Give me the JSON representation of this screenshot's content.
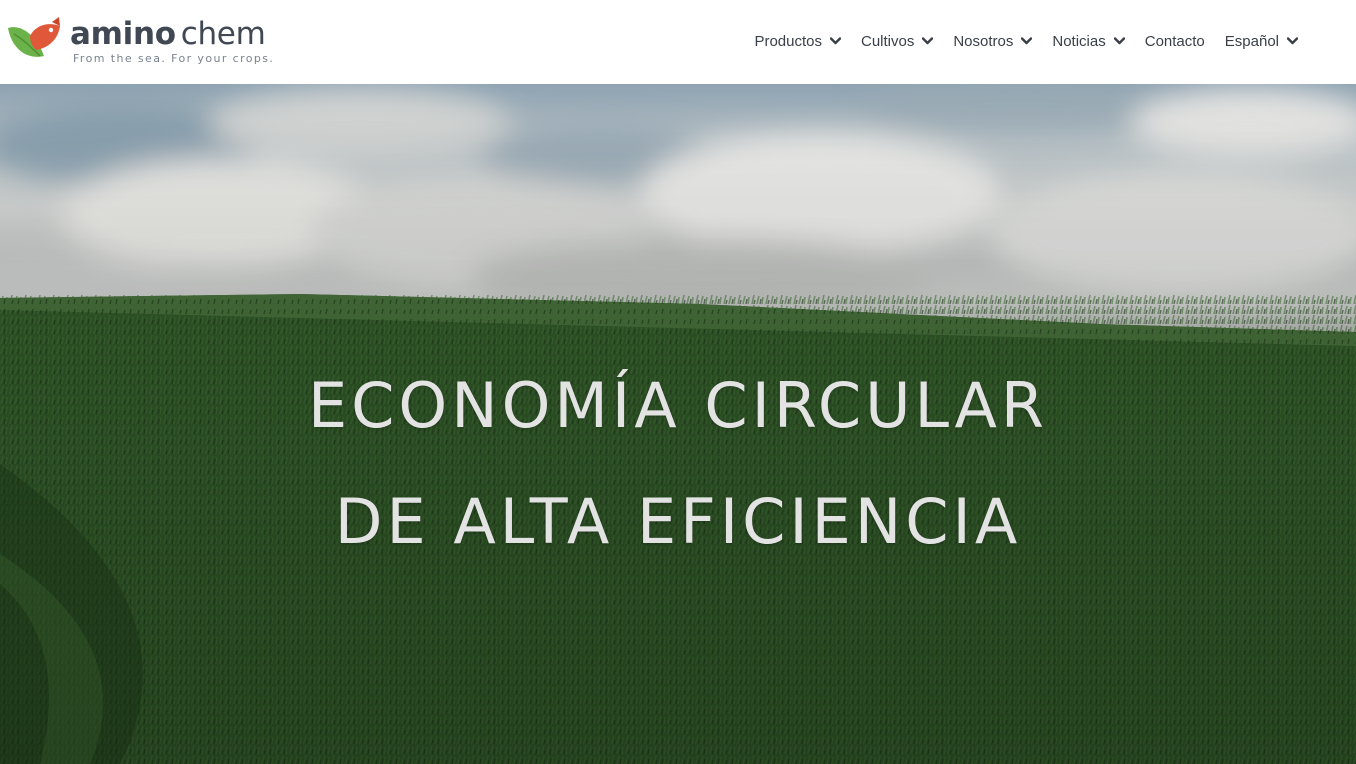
{
  "brand": {
    "name_bold": "amino",
    "name_light": "chem",
    "tagline": "From the sea. For your crops.",
    "colors": {
      "text": "#3f4853",
      "leaf": "#6bb24a",
      "fish": "#e0583a"
    }
  },
  "nav": {
    "items": [
      {
        "label": "Productos",
        "has_dropdown": true,
        "icon": "chevron-down-icon"
      },
      {
        "label": "Cultivos",
        "has_dropdown": true,
        "icon": "chevron-down-icon"
      },
      {
        "label": "Nosotros",
        "has_dropdown": true,
        "icon": "chevron-down-icon"
      },
      {
        "label": "Noticias",
        "has_dropdown": true,
        "icon": "chevron-down-icon"
      },
      {
        "label": "Contacto",
        "has_dropdown": false
      },
      {
        "label": "Español",
        "has_dropdown": true,
        "icon": "chevron-down-icon"
      }
    ]
  },
  "hero": {
    "line1": "ECONOMÍA CIRCULAR",
    "line2": "DE ALTA EFICIENCIA",
    "background": "cloudy sky over green crop field",
    "colors": {
      "text": "#e3e3e3",
      "field": "#2f5527"
    }
  }
}
